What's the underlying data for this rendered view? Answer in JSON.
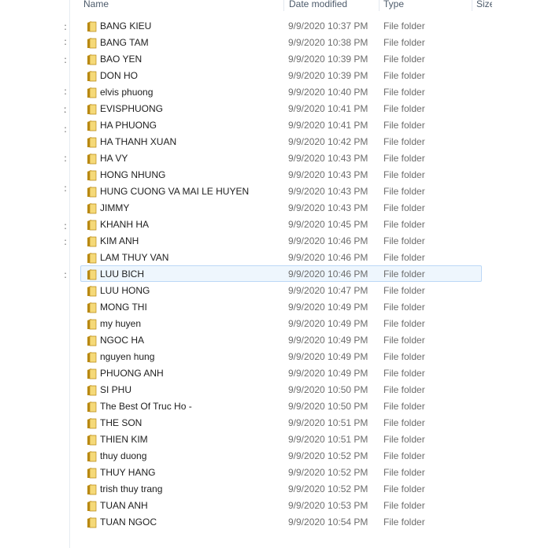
{
  "columns": {
    "name": "Name",
    "date_modified": "Date modified",
    "type": "Type",
    "size": "Size"
  },
  "left_pane_marks": [
    ":",
    ":",
    ":",
    ":",
    "ː",
    ":",
    ":",
    ":",
    ":",
    ":",
    ":"
  ],
  "hovered_row_index": 15,
  "folder_icon_colors": {
    "back": "#d9a326",
    "front": "#f5d978",
    "edge": "#b98912"
  },
  "rows": [
    {
      "name": "BANG KIEU",
      "date": "9/9/2020 10:37 PM",
      "type": "File folder"
    },
    {
      "name": "BANG TAM",
      "date": "9/9/2020 10:38 PM",
      "type": "File folder"
    },
    {
      "name": "BAO YEN",
      "date": "9/9/2020 10:39 PM",
      "type": "File folder"
    },
    {
      "name": "DON HO",
      "date": "9/9/2020 10:39 PM",
      "type": "File folder"
    },
    {
      "name": "elvis phuong",
      "date": "9/9/2020 10:40 PM",
      "type": "File folder"
    },
    {
      "name": "EVISPHUONG",
      "date": "9/9/2020 10:41 PM",
      "type": "File folder"
    },
    {
      "name": "HA PHUONG",
      "date": "9/9/2020 10:41 PM",
      "type": "File folder"
    },
    {
      "name": "HA THANH XUAN",
      "date": "9/9/2020 10:42 PM",
      "type": "File folder"
    },
    {
      "name": "HA VY",
      "date": "9/9/2020 10:43 PM",
      "type": "File folder"
    },
    {
      "name": "HONG NHUNG",
      "date": "9/9/2020 10:43 PM",
      "type": "File folder"
    },
    {
      "name": "HUNG CUONG VA MAI LE HUYEN",
      "date": "9/9/2020 10:43 PM",
      "type": "File folder"
    },
    {
      "name": "JIMMY",
      "date": "9/9/2020 10:43 PM",
      "type": "File folder"
    },
    {
      "name": "KHANH HA",
      "date": "9/9/2020 10:45 PM",
      "type": "File folder"
    },
    {
      "name": "KIM ANH",
      "date": "9/9/2020 10:46 PM",
      "type": "File folder"
    },
    {
      "name": "LAM THUY VAN",
      "date": "9/9/2020 10:46 PM",
      "type": "File folder"
    },
    {
      "name": "LUU BICH",
      "date": "9/9/2020 10:46 PM",
      "type": "File folder"
    },
    {
      "name": "LUU HONG",
      "date": "9/9/2020 10:47 PM",
      "type": "File folder"
    },
    {
      "name": "MONG THI",
      "date": "9/9/2020 10:49 PM",
      "type": "File folder"
    },
    {
      "name": "my huyen",
      "date": "9/9/2020 10:49 PM",
      "type": "File folder"
    },
    {
      "name": "NGOC HA",
      "date": "9/9/2020 10:49 PM",
      "type": "File folder"
    },
    {
      "name": "nguyen hung",
      "date": "9/9/2020 10:49 PM",
      "type": "File folder"
    },
    {
      "name": "PHUONG ANH",
      "date": "9/9/2020 10:49 PM",
      "type": "File folder"
    },
    {
      "name": "SI PHU",
      "date": "9/9/2020 10:50 PM",
      "type": "File folder"
    },
    {
      "name": "The Best Of Truc Ho -",
      "date": "9/9/2020 10:50 PM",
      "type": "File folder"
    },
    {
      "name": "THE SON",
      "date": "9/9/2020 10:51 PM",
      "type": "File folder"
    },
    {
      "name": "THIEN KIM",
      "date": "9/9/2020 10:51 PM",
      "type": "File folder"
    },
    {
      "name": "thuy duong",
      "date": "9/9/2020 10:52 PM",
      "type": "File folder"
    },
    {
      "name": "THUY HANG",
      "date": "9/9/2020 10:52 PM",
      "type": "File folder"
    },
    {
      "name": "trish thuy trang",
      "date": "9/9/2020 10:52 PM",
      "type": "File folder"
    },
    {
      "name": "TUAN ANH",
      "date": "9/9/2020 10:53 PM",
      "type": "File folder"
    },
    {
      "name": "TUAN NGOC",
      "date": "9/9/2020 10:54 PM",
      "type": "File folder"
    }
  ]
}
